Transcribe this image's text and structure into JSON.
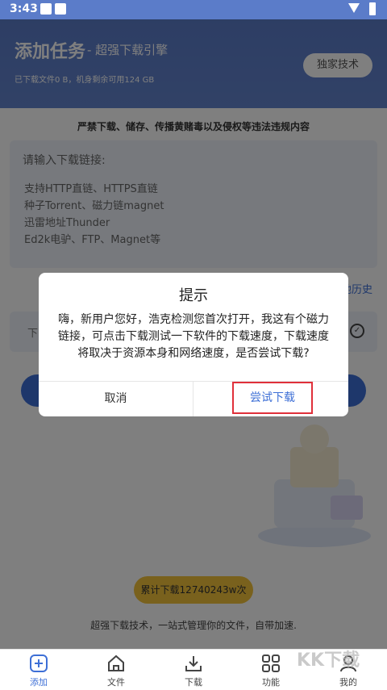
{
  "status_bar": {
    "time": "3:43"
  },
  "header": {
    "title": "添加任务",
    "subtitle": "- 超强下载引擎",
    "storage": "已下载文件0 B，机身剩余可用124 GB",
    "tech_button": "独家技术"
  },
  "notice": "严禁下载、储存、传播黄赌毒以及侵权等违法违规内容",
  "input": {
    "label": "请输入下载链接:",
    "hints": [
      "支持HTTP直链、HTTPS直链",
      "种子Torrent、磁力链magnet",
      "迅雷地址Thunder",
      "Ed2k电驴、FTP、Magnet等"
    ]
  },
  "history_link": "地历史",
  "path_label": "下",
  "counter": "累计下载12740243w次",
  "tagline": "超强下载技术，一站式管理你的文件，自带加速.",
  "nav": [
    {
      "label": "添加",
      "icon": "add-icon"
    },
    {
      "label": "文件",
      "icon": "home-icon"
    },
    {
      "label": "下载",
      "icon": "download-icon"
    },
    {
      "label": "功能",
      "icon": "grid-icon"
    },
    {
      "label": "我的",
      "icon": "user-icon"
    }
  ],
  "dialog": {
    "title": "提示",
    "message": "嗨，新用户您好，浩克检测您首次打开，我这有个磁力链接，可点击下载测试一下软件的下载速度，下载速度将取决于资源本身和网络速度，是否尝试下载?",
    "cancel": "取消",
    "confirm": "尝试下载"
  },
  "watermark": "KK下载",
  "colors": {
    "primary": "#3d6fd6",
    "header": "#5b7cc9",
    "highlight": "#e0303a",
    "badge": "#f2c23b"
  }
}
